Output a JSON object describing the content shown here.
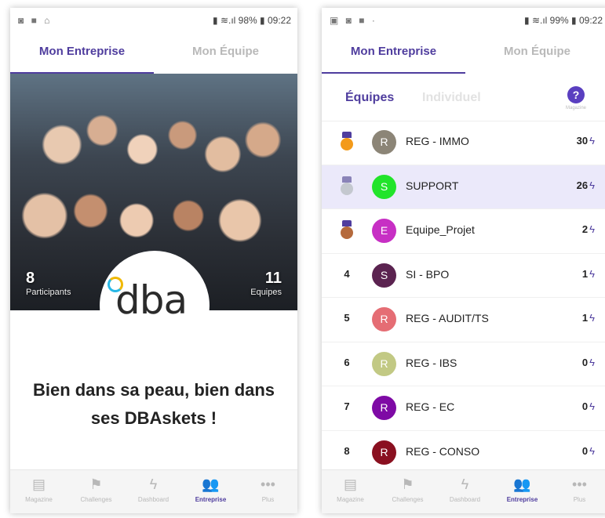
{
  "phone1": {
    "status": {
      "icons_left": "◙ ■ ⌂",
      "right": "▮ ≋.ıl 98% ▮ 09:22"
    },
    "tabs": {
      "left": "Mon Entreprise",
      "right": "Mon Équipe"
    },
    "hero": {
      "participants_count": "8",
      "participants_label": "Participants",
      "teams_count": "11",
      "teams_label": "Equipes"
    },
    "logo_text": "dba",
    "slogan": "Bien dans sa peau, bien dans ses DBAskets !",
    "nav": [
      {
        "label": "Magazine",
        "icon": "magazine-icon"
      },
      {
        "label": "Challenges",
        "icon": "flag-icon"
      },
      {
        "label": "Dashboard",
        "icon": "bolt-icon"
      },
      {
        "label": "Entreprise",
        "icon": "people-icon"
      },
      {
        "label": "Plus",
        "icon": "more-icon"
      }
    ]
  },
  "phone2": {
    "status": {
      "icons_left": "▣ ◙ ■ ·",
      "right": "▮ ≋.ıl 99% ▮ 09:22"
    },
    "tabs": {
      "left": "Mon Entreprise",
      "right": "Mon Équipe"
    },
    "subtabs": {
      "active": "Équipes",
      "inactive": "Individuel",
      "help_label": "Magazine"
    },
    "rows": [
      {
        "rank": "",
        "medal": "gold",
        "initial": "R",
        "color": "#8c8577",
        "name": "REG - IMMO",
        "score": "30"
      },
      {
        "rank": "",
        "medal": "silver",
        "initial": "S",
        "color": "#22e42a",
        "name": "SUPPORT",
        "score": "26"
      },
      {
        "rank": "",
        "medal": "bronze",
        "initial": "E",
        "color": "#c72fc4",
        "name": "Equipe_Projet",
        "score": "2"
      },
      {
        "rank": "4",
        "medal": "",
        "initial": "S",
        "color": "#5b2350",
        "name": "SI - BPO",
        "score": "1"
      },
      {
        "rank": "5",
        "medal": "",
        "initial": "R",
        "color": "#e56d74",
        "name": "REG - AUDIT/TS",
        "score": "1"
      },
      {
        "rank": "6",
        "medal": "",
        "initial": "R",
        "color": "#c2c984",
        "name": "REG - IBS",
        "score": "0"
      },
      {
        "rank": "7",
        "medal": "",
        "initial": "R",
        "color": "#7e0aa5",
        "name": "REG - EC",
        "score": "0"
      },
      {
        "rank": "8",
        "medal": "",
        "initial": "R",
        "color": "#8a1020",
        "name": "REG - CONSO",
        "score": "0"
      }
    ],
    "nav": [
      {
        "label": "Magazine",
        "icon": "magazine-icon"
      },
      {
        "label": "Challenges",
        "icon": "flag-icon"
      },
      {
        "label": "Dashboard",
        "icon": "bolt-icon"
      },
      {
        "label": "Entreprise",
        "icon": "people-icon"
      },
      {
        "label": "Plus",
        "icon": "more-icon"
      }
    ]
  },
  "colors": {
    "accent": "#4f3d9e",
    "highlight": "#ebe9fa"
  }
}
